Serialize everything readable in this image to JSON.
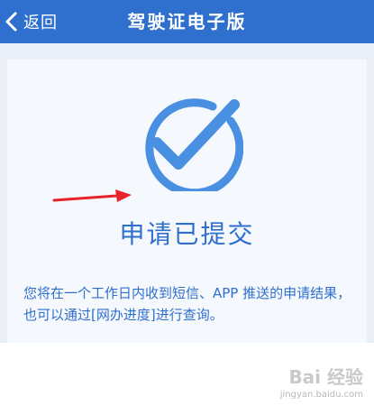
{
  "header": {
    "back_label": "返回",
    "title": "驾驶证电子版"
  },
  "status": {
    "title": "申请已提交",
    "description": "您将在一个工作日内收到短信、APP 推送的申请结果，也可以通过[网办进度]进行查询。"
  },
  "watermark": {
    "brand": "Bai 经验",
    "url": "jingyan.baidu.com"
  },
  "colors": {
    "primary": "#2f6fcd",
    "check": "#4a90e2",
    "arrow": "#e8222b",
    "background": "#e9eef7",
    "card": "#f5f8fd"
  },
  "icons": {
    "back": "chevron-left-icon",
    "check": "checkmark-circle-icon",
    "arrow": "red-arrow-icon"
  }
}
